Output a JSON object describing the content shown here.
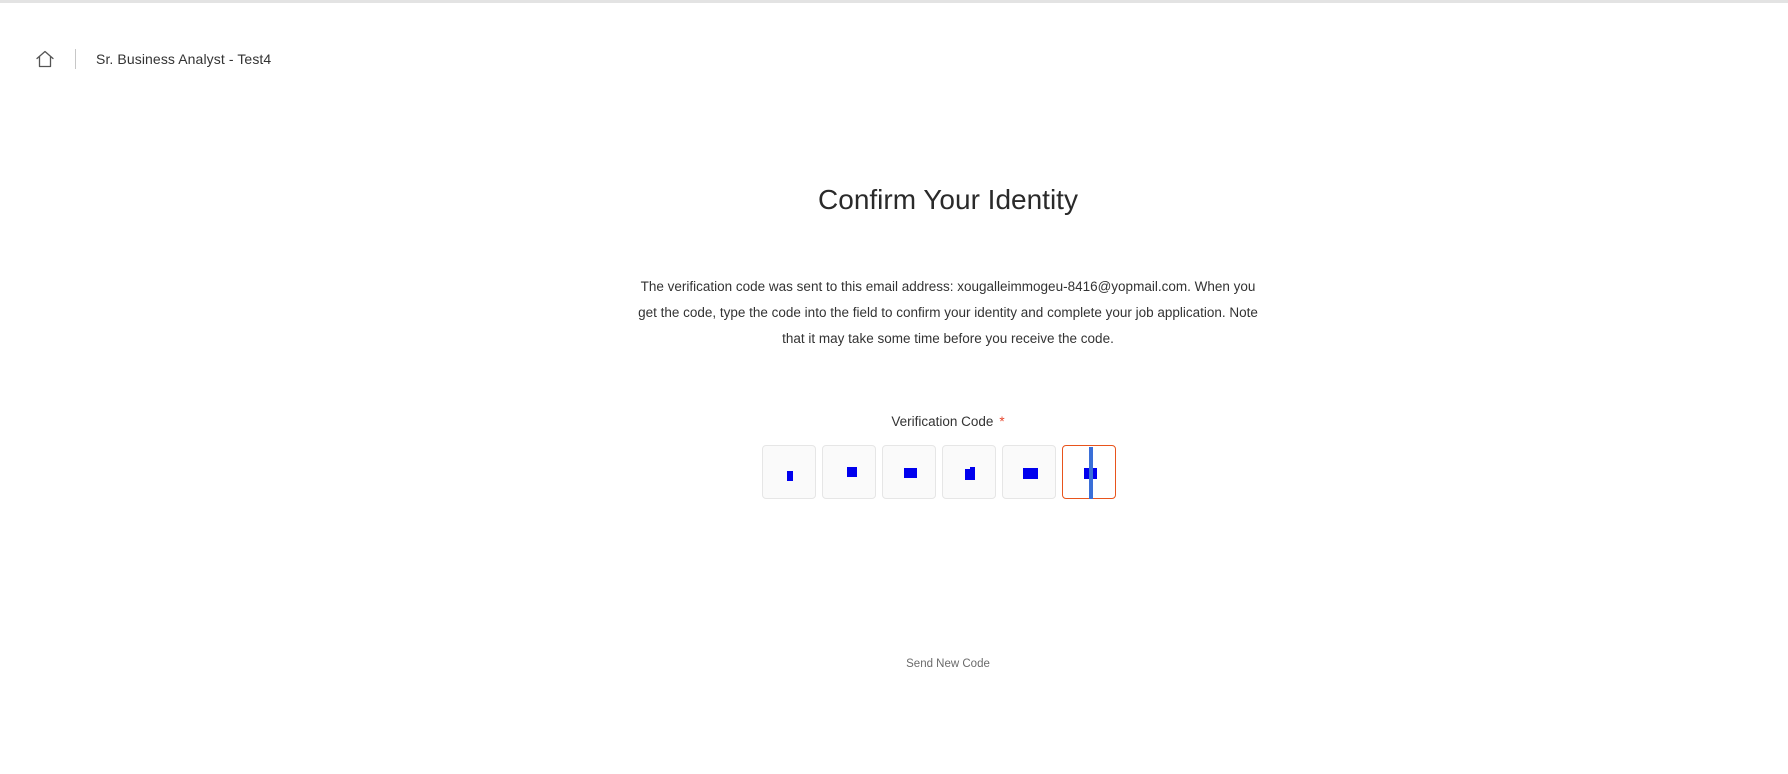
{
  "header": {
    "home_icon": "home-icon",
    "job_title": "Sr. Business Analyst - Test4"
  },
  "main": {
    "title": "Confirm Your Identity",
    "instructions": "The verification code was sent to this email address: xougalleimmogeu-8416@yopmail.com. When you get the code, type the code into the field to confirm your identity and complete your job application. Note that it may take some time before you receive the code.",
    "verification": {
      "label": "Verification Code",
      "required_mark": "*",
      "digits": [
        "",
        "",
        "",
        "",
        "",
        ""
      ],
      "active_index": 5
    },
    "send_new_code_label": "Send New Code"
  },
  "colors": {
    "accent": "#e8541c",
    "required": "#e8472e",
    "caret": "#3a6fd8",
    "redaction": "#0000ee"
  }
}
